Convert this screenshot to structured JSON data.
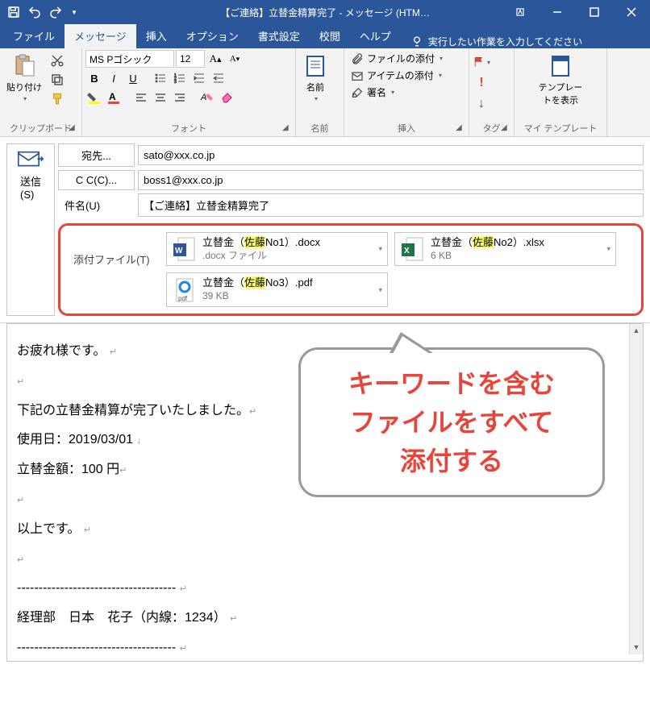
{
  "titlebar": {
    "title": "【ご連絡】立替金精算完了 - メッセージ (HTM…"
  },
  "tabs": {
    "file": "ファイル",
    "message": "メッセージ",
    "insert": "挿入",
    "options": "オプション",
    "format": "書式設定",
    "review": "校閲",
    "help": "ヘルプ",
    "tellme": "実行したい作業を入力してください"
  },
  "ribbon": {
    "clipboard": {
      "paste": "貼り付け",
      "label": "クリップボード"
    },
    "font": {
      "name": "MS Pゴシック",
      "size": "12",
      "label": "フォント"
    },
    "names": {
      "addressbook": "名前",
      "label": "名前"
    },
    "insert": {
      "attachfile": "ファイルの添付",
      "attachitem": "アイテムの添付",
      "signature": "署名",
      "label": "挿入"
    },
    "tags": {
      "label": "タグ"
    },
    "template": {
      "btn": "テンプレー\nトを表示",
      "label": "マイ テンプレート"
    }
  },
  "compose": {
    "send": "送信\n(S)",
    "to_label": "宛先...",
    "to": "sato@xxx.co.jp",
    "cc_label": "C C(C)...",
    "cc": "boss1@xxx.co.jp",
    "subject_label": "件名(U)",
    "subject": "【ご連絡】立替金精算完了",
    "attach_label": "添付ファイル(T)",
    "attachments": [
      {
        "pre": "立替金（",
        "hl": "佐藤",
        "post": "No1）.docx",
        "sub": ".docx ファイル",
        "type": "docx"
      },
      {
        "pre": "立替金（",
        "hl": "佐藤",
        "post": "No2）.xlsx",
        "sub": "6 KB",
        "type": "xlsx"
      },
      {
        "pre": "立替金（",
        "hl": "佐藤",
        "post": "No3）.pdf",
        "sub": "39 KB",
        "type": "pdf"
      }
    ]
  },
  "body": {
    "l1": "お疲れ様です。",
    "blank": "",
    "l2": "下記の立替金精算が完了いたしました。",
    "l3": "使用日：2019/03/01",
    "l4": "立替金額：100 円",
    "l5": "以上です。",
    "l6": "-------------------------------------",
    "l7": "経理部　日本　花子（内線：1234）",
    "l8": "-------------------------------------"
  },
  "callout": {
    "text": "キーワードを含む\nファイルをすべて\n添付する"
  }
}
